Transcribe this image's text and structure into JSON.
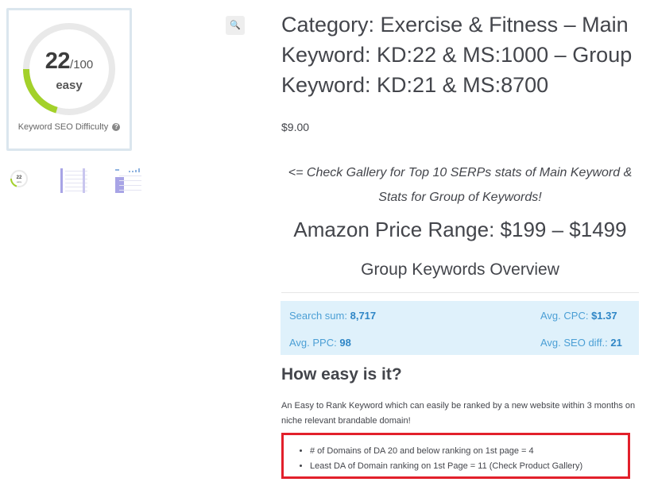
{
  "gallery": {
    "score": "22",
    "score_max": "/100",
    "score_label": "easy",
    "caption": "Keyword SEO Difficulty",
    "help_icon": "?",
    "zoom_icon": "🔍",
    "gauge_color": "#a3d12a",
    "gauge_track_color": "#e9e9e9",
    "thumbnails": [
      "thumbnail-kd-gauge",
      "thumbnail-serp-chart",
      "thumbnail-keywords-chart"
    ]
  },
  "product": {
    "title": "Category: Exercise & Fitness – Main Keyword: KD:22 & MS:1000 – Group Keyword: KD:21 & MS:8700",
    "price": "$9.00",
    "gallery_note": "<= Check Gallery for Top 10 SERPs stats of Main Keyword & Stats for Group of Keywords!",
    "amazon_price_range": "Amazon Price Range: $199 – $1499"
  },
  "group_overview": {
    "title": "Group Keywords Overview",
    "search_sum_label": "Search sum:",
    "search_sum_value": "8,717",
    "avg_cpc_label": "Avg. CPC:",
    "avg_cpc_value": "$1.37",
    "avg_ppc_label": "Avg. PPC:",
    "avg_ppc_value": "98",
    "avg_seo_label": "Avg. SEO diff.:",
    "avg_seo_value": "21"
  },
  "how_easy": {
    "title": "How easy is it?",
    "description": "An Easy to Rank Keyword which can easily be ranked by a new website within 3 months on niche relevant brandable domain!",
    "bullets": [
      "# of Domains of DA 20 and below ranking on 1st page = 4",
      "Least DA of Domain ranking on 1st Page = 11 (Check Product Gallery)"
    ]
  },
  "colors": {
    "highlight_border": "#e2202b",
    "stats_background": "#dff1fb",
    "stats_text": "#4b9fd5"
  }
}
